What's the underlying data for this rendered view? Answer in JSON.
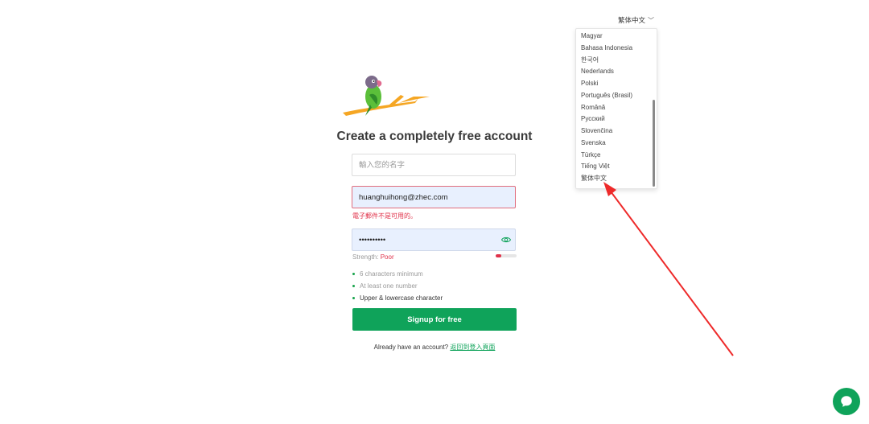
{
  "language": {
    "current": "繁体中文",
    "options": [
      "Magyar",
      "Bahasa Indonesia",
      "한국어",
      "Nederlands",
      "Polski",
      "Português (Brasil)",
      "Română",
      "Русский",
      "Slovenčina",
      "Svenska",
      "Türkçe",
      "Tiếng Việt",
      "繁体中文"
    ]
  },
  "form": {
    "title": "Create a completely free account",
    "name_placeholder": "輸入您的名字",
    "name_value": "",
    "email_value": "huanghuihong@zhec.com",
    "email_error": "電子郵件不是可用的。",
    "password_value": "••••••••••",
    "strength_label": "Strength:",
    "strength_value": "Poor",
    "strength_level": 0.25,
    "rules": [
      {
        "text": "6 characters minimum",
        "met": false
      },
      {
        "text": "At least one number",
        "met": false
      },
      {
        "text": "Upper & lowercase character",
        "met": true
      }
    ],
    "signup_label": "Signup for free",
    "login_prompt": "Already have an account?",
    "login_link": "返回到登入頁面"
  },
  "colors": {
    "brand": "#0fa35a",
    "error": "#e0324a",
    "annotation": "#ee2a2a"
  }
}
